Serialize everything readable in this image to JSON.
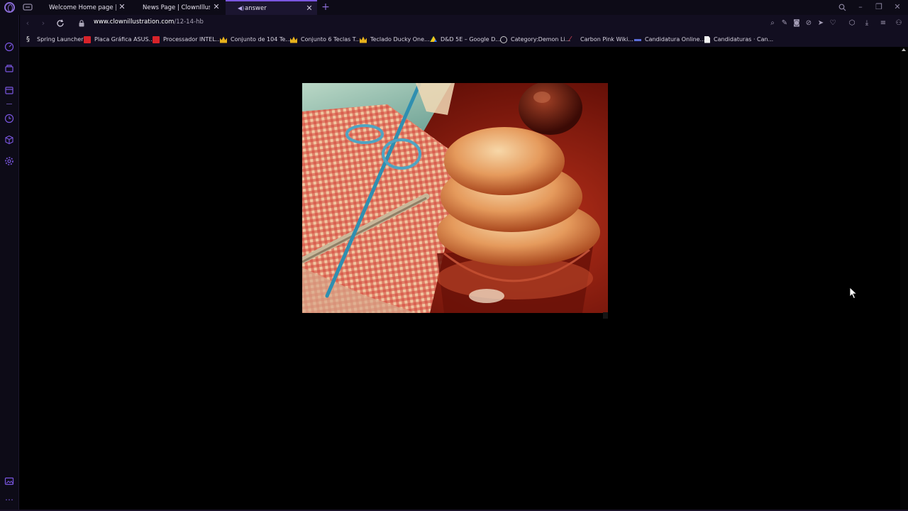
{
  "tabs": [
    {
      "title": "Welcome Home page | Clo",
      "active": false
    },
    {
      "title": "News Page | ClownIllustrati",
      "active": false
    },
    {
      "title": "answer",
      "active": true
    }
  ],
  "address": {
    "url_host": "www.clownillustration.com",
    "url_path": "/12-14-hb"
  },
  "bookmarks": [
    {
      "label": "Spring Launcher",
      "icon": "spring-icon",
      "color": "#e8e8e8"
    },
    {
      "label": "Placa Gráfica ASUS...",
      "icon": "store-icon",
      "color": "#d8232a"
    },
    {
      "label": "Processador INTEL...",
      "icon": "store-icon",
      "color": "#d8232a"
    },
    {
      "label": "Conjunto de 104 Te...",
      "icon": "crown-icon",
      "color": "#e7b21c"
    },
    {
      "label": "Conjunto 6 Teclas T...",
      "icon": "crown-icon",
      "color": "#e7b21c"
    },
    {
      "label": "Teclado Ducky One...",
      "icon": "crown-icon",
      "color": "#e7b21c"
    },
    {
      "label": "D&D 5E – Google D...",
      "icon": "drive-icon",
      "color": "#2fa14f"
    },
    {
      "label": "Category:Demon Li...",
      "icon": "wiki-icon",
      "color": "#cfcfcf"
    },
    {
      "label": "Carbon Pink Wiki...",
      "icon": "feather-icon",
      "color": "#e0455a"
    },
    {
      "label": "Candidatura Online...",
      "icon": "dash-icon",
      "color": "#5b6dd8"
    },
    {
      "label": "Candidaturas · Can...",
      "icon": "document-icon",
      "color": "#f2f2f2"
    }
  ],
  "colors": {
    "accent": "#7a56e0",
    "tab_background": "#0d0b17",
    "toolbar_background": "#120e20",
    "content_background": "#000000"
  }
}
